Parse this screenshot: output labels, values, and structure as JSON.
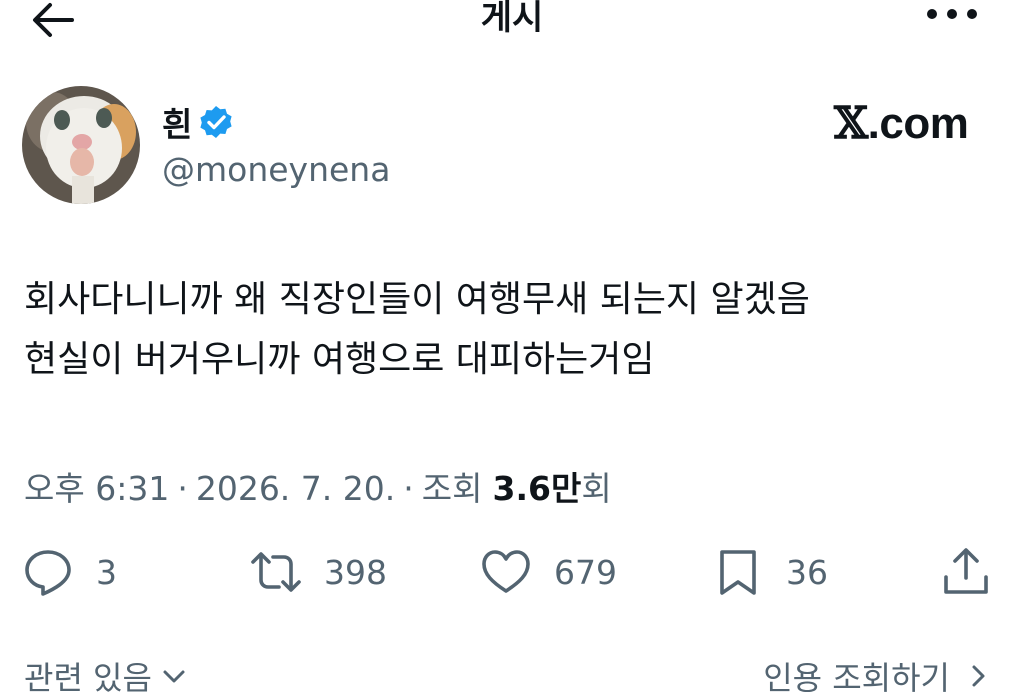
{
  "header": {
    "title": "게시",
    "back_icon": "arrow-left-icon",
    "more_icon": "more-horizontal-icon"
  },
  "author": {
    "display_name": "흰",
    "handle": "@moneynena",
    "verified": true,
    "verified_color": "#1d9bf0",
    "avatar_icon": "cat-avatar-image"
  },
  "brand": {
    "x_letter": "𝕏",
    "suffix": ".com"
  },
  "tweet": {
    "text": "회사다니니까 왜 직장인들이 여행무새 되는지 알겠음\n현실이 버거우니까 여행으로 대피하는거임"
  },
  "meta": {
    "time": "오후 6:31",
    "separator": "·",
    "date": "2026. 7. 20.",
    "views_label": "조회",
    "views_count": "3.6만",
    "views_suffix": "회"
  },
  "actions": {
    "reply": {
      "icon": "reply-icon",
      "count": "3"
    },
    "retweet": {
      "icon": "retweet-icon",
      "count": "398"
    },
    "like": {
      "icon": "heart-icon",
      "count": "679"
    },
    "bookmark": {
      "icon": "bookmark-icon",
      "count": "36"
    },
    "share": {
      "icon": "share-icon"
    }
  },
  "footer": {
    "related_label": "관련 있음",
    "quotes_label": "인용 조회하기"
  },
  "colors": {
    "text_primary": "#0f1419",
    "text_secondary": "#536471",
    "accent": "#1d9bf0"
  }
}
